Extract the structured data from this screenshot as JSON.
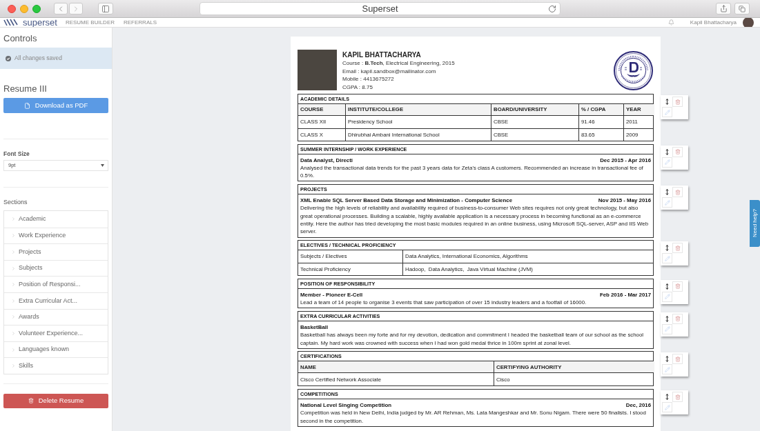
{
  "browser": {
    "title": "Superset"
  },
  "app_header": {
    "logo": "superset",
    "nav": [
      "RESUME BUILDER",
      "REFERRALS"
    ],
    "user_name": "Kapil Bhattacharya"
  },
  "sidebar": {
    "title": "Controls",
    "save_status": "All changes saved",
    "resume_name": "Resume III",
    "download_button": "Download as PDF",
    "font_size": {
      "label": "Font Size",
      "value": "9pt"
    },
    "sections_label": "Sections",
    "sections": [
      "Academic",
      "Work Experience",
      "Projects",
      "Subjects",
      "Position of Responsi...",
      "Extra Curricular Act...",
      "Awards",
      "Volunteer Experience...",
      "Languages known",
      "Skills"
    ],
    "delete_button": "Delete Resume"
  },
  "resume": {
    "header": {
      "name": "KAPIL BHATTACHARYA",
      "lines": [
        "Course : **B.Tech**, Electrical Engineering, 2015",
        "Email : kapil.sandbox@mailinator.com",
        "Mobile : 4413675272",
        "CGPA : 8.75"
      ]
    },
    "sections": [
      {
        "kind": "table",
        "title": "ACADEMIC DETAILS",
        "columns": [
          "COURSE",
          "INSTITUTE/COLLEGE",
          "BOARD/UNIVERSITY",
          "% / CGPA",
          "YEAR"
        ],
        "rows": [
          [
            "CLASS XII",
            "Presidency School",
            "CBSE",
            "91.46",
            "2011"
          ],
          [
            "CLASS X",
            "Dhirubhai Ambani International School",
            "CBSE",
            "83.65",
            "2009"
          ]
        ]
      },
      {
        "kind": "entry",
        "title": "SUMMER INTERNSHIP / WORK EXPERIENCE",
        "heading": "Data Analyst, Directi",
        "date": "Dec 2015 - Apr 2016",
        "description": "Analysed the transactional data trends for the past 3 years data for Zeta's class A customers. Recommended an increase in transactional fee of 0.5%."
      },
      {
        "kind": "entry",
        "title": "PROJECTS",
        "heading": "XML Enable SQL Server Based Data Storage and Minimization - Computer Science",
        "date": "Nov 2015 - May 2016",
        "description": "Delivering the high levels of reliability and availability required of business-to-consumer Web sites requires not only great technology, but also great operational processes. Building a scalable, highly available application is a necessary process in becoming functional as an e-commerce entity. Here the author has tried developing the most basic modules required in an online business, using Microsoft SQL-server, ASP and IIS Web server."
      },
      {
        "kind": "pairs",
        "title": "ELECTIVES / TECHNICAL PROFICIENCY",
        "rows": [
          [
            "Subjects / Electives",
            "Data Analytics, International Economics, Algorithms"
          ],
          [
            "Technical Proficiency",
            "Hadoop,  Data Analytics,  Java Virtual Machine (JVM)"
          ]
        ]
      },
      {
        "kind": "entry",
        "title": "POSITION OF RESPONSIBILITY",
        "heading": "Member - Pioneer E-Cell",
        "date": "Feb 2016 - Mar 2017",
        "description": "Lead a team of 14 people to organise 3 events that saw participation of over 15 industry leaders and a footfall of 16000."
      },
      {
        "kind": "entry",
        "title": "EXTRA CURRICULAR ACTIVITIES",
        "heading": "BasketBall",
        "description": "Basketball has always been my forte and for my devotion, dedication and commitment I headed the basketball team of our school as the school captain. My hard work was crowned with success when I had won gold medal thrice in 100m sprint at zonal level."
      },
      {
        "kind": "table",
        "title": "CERTIFICATIONS",
        "columns": [
          "NAME",
          "CERTIFYING AUTHORITY"
        ],
        "rows": [
          [
            "Cisco Certified Network Associate",
            "Cisco"
          ]
        ]
      },
      {
        "kind": "entry",
        "title": "COMPETITIONS",
        "heading": "National Level Singing Competition",
        "date": "Dec, 2016",
        "description": "Competition was held in New Delhi, India judged by Mr. AR Rehman, Ms. Lata Mangeshkar and Mr. Sonu Nigam. There were 50 finalists. I stood second in the competition."
      }
    ]
  },
  "help_tab": "Need help?"
}
